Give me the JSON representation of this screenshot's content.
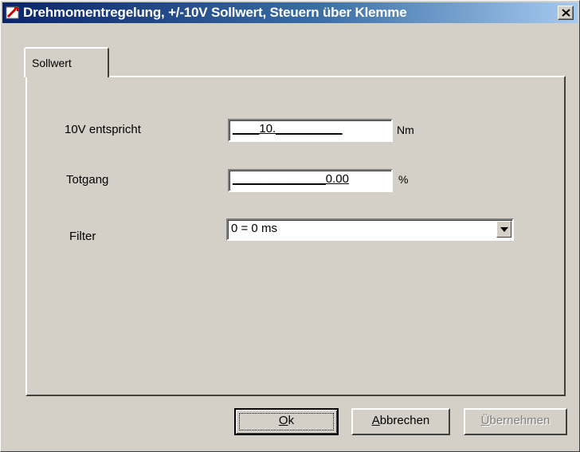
{
  "window": {
    "title": "Drehmomentregelung, +/-10V Sollwert, Steuern über Klemme",
    "close_label": "×"
  },
  "tabs": [
    {
      "label": "Sollwert"
    }
  ],
  "form": {
    "rows": [
      {
        "label": "10V entspricht",
        "value": "____10.__________",
        "unit": "Nm"
      },
      {
        "label": "Totgang",
        "value": "______________0.00",
        "unit": "%"
      }
    ],
    "filter": {
      "label": "Filter",
      "selected": "0 = 0 ms"
    }
  },
  "buttons": {
    "ok": {
      "label": "Ok",
      "accel": "O",
      "rest": "k"
    },
    "cancel": {
      "label": "Abbrechen",
      "accel": "A",
      "rest": "bbrechen"
    },
    "apply": {
      "label": "Übernehmen",
      "accel": "Ü",
      "rest": "bernehmen",
      "disabled": true
    }
  },
  "colors": {
    "titlebar_start": "#0a246a",
    "titlebar_end": "#a6caf0",
    "face": "#d4d0c8"
  },
  "icons": {
    "app": "app-icon",
    "close": "close-icon",
    "dropdown": "chevron-down-icon"
  }
}
